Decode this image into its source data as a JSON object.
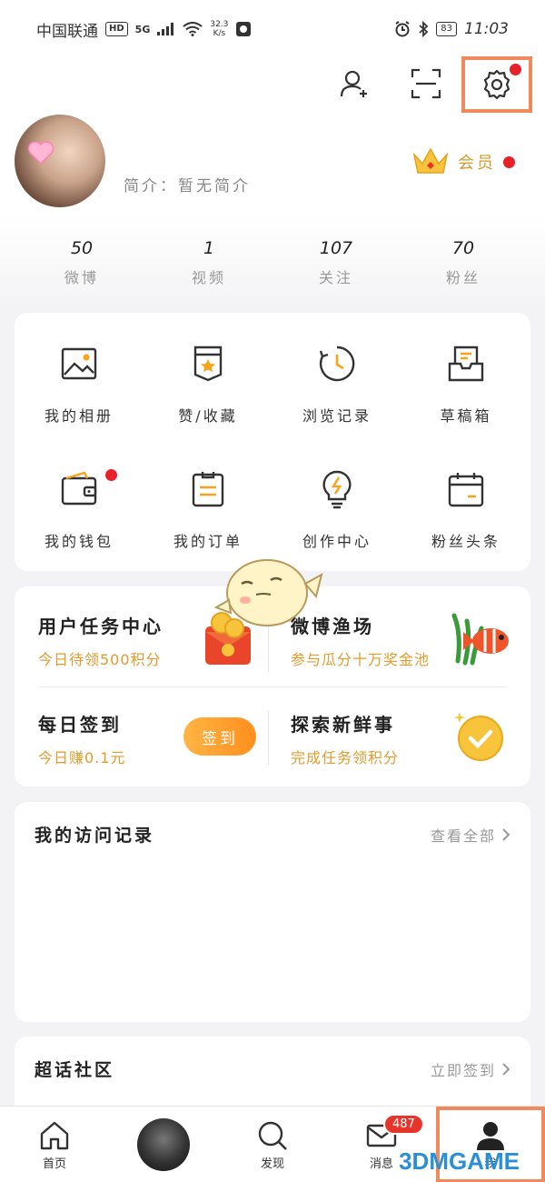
{
  "status_bar": {
    "carrier": "中国联通",
    "network_chip": "HD",
    "signal": "5G",
    "net_speed_value": "32.3",
    "net_speed_unit": "K/s",
    "battery": "83",
    "time": "11:03"
  },
  "header": {
    "icons": [
      "add-friend-icon",
      "scan-icon",
      "settings-icon"
    ]
  },
  "profile": {
    "bio": "简介：暂无简介",
    "vip_label": "会员"
  },
  "stats": [
    {
      "value": "50",
      "label": "微博"
    },
    {
      "value": "1",
      "label": "视频"
    },
    {
      "value": "107",
      "label": "关注"
    },
    {
      "value": "70",
      "label": "粉丝"
    }
  ],
  "shortcuts": [
    {
      "label": "我的相册",
      "icon": "album-icon"
    },
    {
      "label": "赞/收藏",
      "icon": "favorite-icon"
    },
    {
      "label": "浏览记录",
      "icon": "history-icon"
    },
    {
      "label": "草稿箱",
      "icon": "drafts-icon"
    },
    {
      "label": "我的钱包",
      "icon": "wallet-icon"
    },
    {
      "label": "我的订单",
      "icon": "orders-icon"
    },
    {
      "label": "创作中心",
      "icon": "creator-center-icon"
    },
    {
      "label": "粉丝头条",
      "icon": "fans-headline-icon"
    }
  ],
  "tasks": {
    "task_center": {
      "title": "用户任务中心",
      "subtitle": "今日待领500积分"
    },
    "fishery": {
      "title": "微博渔场",
      "subtitle": "参与瓜分十万奖金池"
    },
    "checkin": {
      "title": "每日签到",
      "subtitle": "今日赚0.1元",
      "button": "签到"
    },
    "explore": {
      "title": "探索新鲜事",
      "subtitle": "完成任务领积分"
    }
  },
  "visit_history": {
    "title": "我的访问记录",
    "link": "查看全部"
  },
  "super_topic": {
    "title": "超话社区",
    "link": "立即签到"
  },
  "bottom_nav": {
    "home": "首页",
    "discover": "发现",
    "messages_badge": "487",
    "messages": "消息",
    "me": "我"
  },
  "watermark": "3DMGAME",
  "colors": {
    "accent": "#ff8f1c",
    "highlight_box": "#f08a5d",
    "badge_red": "#e8202a",
    "gold": "#e39b2d"
  }
}
